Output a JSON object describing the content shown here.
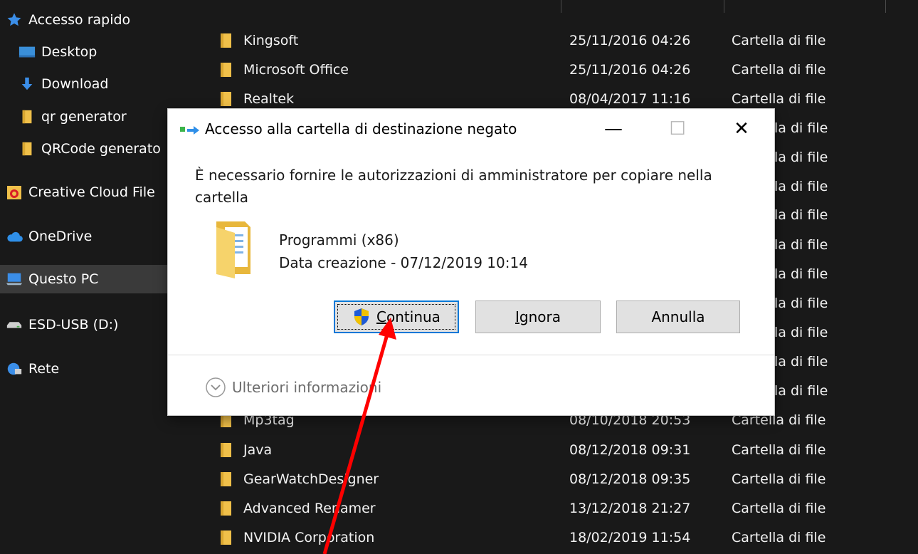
{
  "sidebar": {
    "items": [
      {
        "label": "Accesso rapido",
        "icon": "star-icon"
      },
      {
        "label": "Desktop",
        "icon": "desktop-icon"
      },
      {
        "label": "Download",
        "icon": "download-icon"
      },
      {
        "label": "qr generator",
        "icon": "folder-icon"
      },
      {
        "label": "QRCode generato",
        "icon": "folder-icon"
      },
      {
        "label": "Creative Cloud File",
        "icon": "creative-cloud-icon"
      },
      {
        "label": "OneDrive",
        "icon": "cloud-icon"
      },
      {
        "label": "Questo PC",
        "icon": "computer-icon"
      },
      {
        "label": "ESD-USB (D:)",
        "icon": "usb-drive-icon"
      },
      {
        "label": "Rete",
        "icon": "network-icon"
      }
    ]
  },
  "files": [
    {
      "name": "Kingsoft",
      "date": "25/11/2016 04:26",
      "type": "Cartella di file"
    },
    {
      "name": "Microsoft Office",
      "date": "25/11/2016 04:26",
      "type": "Cartella di file"
    },
    {
      "name": "Realtek",
      "date": "08/04/2017 11:16",
      "type": "Cartella di file"
    },
    {
      "name": "",
      "date": "",
      "type": "la di file"
    },
    {
      "name": "",
      "date": "",
      "type": "la di file"
    },
    {
      "name": "",
      "date": "",
      "type": "la di file"
    },
    {
      "name": "",
      "date": "",
      "type": "la di file"
    },
    {
      "name": "",
      "date": "",
      "type": "la di file"
    },
    {
      "name": "",
      "date": "",
      "type": "la di file"
    },
    {
      "name": "",
      "date": "",
      "type": "la di file"
    },
    {
      "name": "",
      "date": "",
      "type": "la di file"
    },
    {
      "name": "",
      "date": "",
      "type": "la di file"
    },
    {
      "name": "",
      "date": "",
      "type": "la di file"
    },
    {
      "name": "Mp3tag",
      "date": "08/10/2018 20:53",
      "type": "Cartella di file"
    },
    {
      "name": "Java",
      "date": "08/12/2018 09:31",
      "type": "Cartella di file"
    },
    {
      "name": "GearWatchDesigner",
      "date": "08/12/2018 09:35",
      "type": "Cartella di file"
    },
    {
      "name": "Advanced Renamer",
      "date": "13/12/2018 21:27",
      "type": "Cartella di file"
    },
    {
      "name": "NVIDIA Corporation",
      "date": "18/02/2019 11:54",
      "type": "Cartella di file"
    }
  ],
  "dialog": {
    "title": "Accesso alla cartella di destinazione negato",
    "message": "È necessario fornire le autorizzazioni di amministratore per copiare nella cartella",
    "item_name": "Programmi (x86)",
    "item_date": "Data creazione - 07/12/2019 10:14",
    "buttons": {
      "continue_access_key": "C",
      "continue_rest": "ontinua",
      "ignore_access_key": "I",
      "ignore_rest": "gnora",
      "cancel": "Annulla"
    },
    "more_info": "Ulteriori informazioni",
    "window_controls": {
      "minimize": "—",
      "maximize": "☐",
      "close": "✕"
    }
  },
  "colors": {
    "explorer_bg": "#191919",
    "selected_nav": "#3a3a3a",
    "folder_yellow": "#f0c04a",
    "accent_blue": "#0078d7",
    "annotation_red": "#ff0000"
  }
}
